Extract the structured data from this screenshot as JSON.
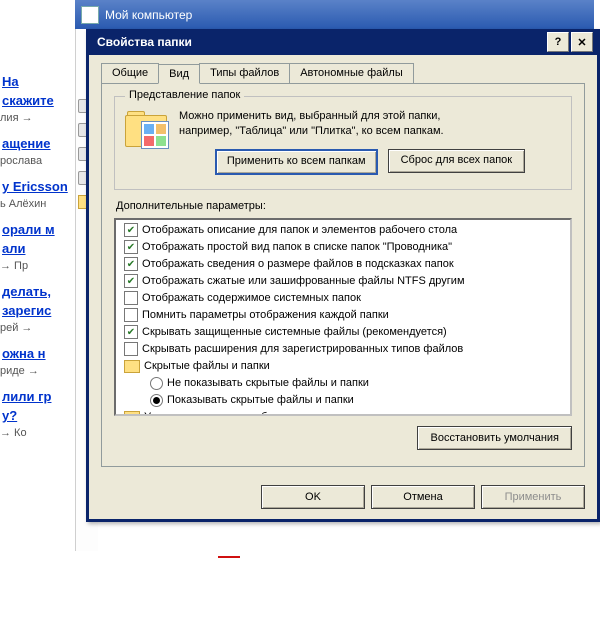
{
  "mc_title": "Мой компьютер",
  "dialog": {
    "title": "Свойства папки",
    "tabs": [
      "Общие",
      "Вид",
      "Типы файлов",
      "Автономные файлы"
    ],
    "group_legend": "Представление папок",
    "desc_line1": "Можно применить вид, выбранный для этой папки,",
    "desc_line2": "например, \"Таблица\" или \"Плитка\", ко всем папкам.",
    "btn_apply_all": "Применить ко всем папкам",
    "btn_reset_all": "Сброс для всех папок",
    "adv_label": "Дополнительные параметры:",
    "btn_restore": "Восстановить умолчания",
    "btn_ok": "OK",
    "btn_cancel": "Отмена",
    "btn_apply": "Применить"
  },
  "tree": {
    "i0": "Отображать описание для папок и элементов рабочего стола",
    "i1": "Отображать простой вид папок в списке папок \"Проводника\"",
    "i2": "Отображать сведения о размере файлов в подсказках папок",
    "i3": "Отображать сжатые или зашифрованные файлы NTFS другим",
    "i4": "Отображать содержимое системных папок",
    "i5": "Помнить параметры отображения каждой папки",
    "i6": "Скрывать защищенные системные файлы (рекомендуется)",
    "i7": "Скрывать расширения для зарегистрированных типов файлов",
    "i8": "Скрытые файлы и папки",
    "i8a": "Не показывать скрытые файлы и папки",
    "i8b": "Показывать скрытые файлы и папки",
    "i9": "Управление парами веб-страниц и папок"
  },
  "bg": {
    "l0": "На",
    "l1": "скажите",
    "s1": "лия →",
    "l2": "ащение",
    "s2": "рослава",
    "l3": "у Ericsson",
    "s3": "ь Алёхин",
    "l4": "орали м",
    "l4b": "али",
    "s4": " → Пр",
    "l5": "делать,",
    "l5b": "зарегис",
    "s5": "рей →",
    "l6": "ожна н",
    "s6": "риде →",
    "l7": "лили гр",
    "l7b": "у?",
    "s7": " → Ко"
  }
}
